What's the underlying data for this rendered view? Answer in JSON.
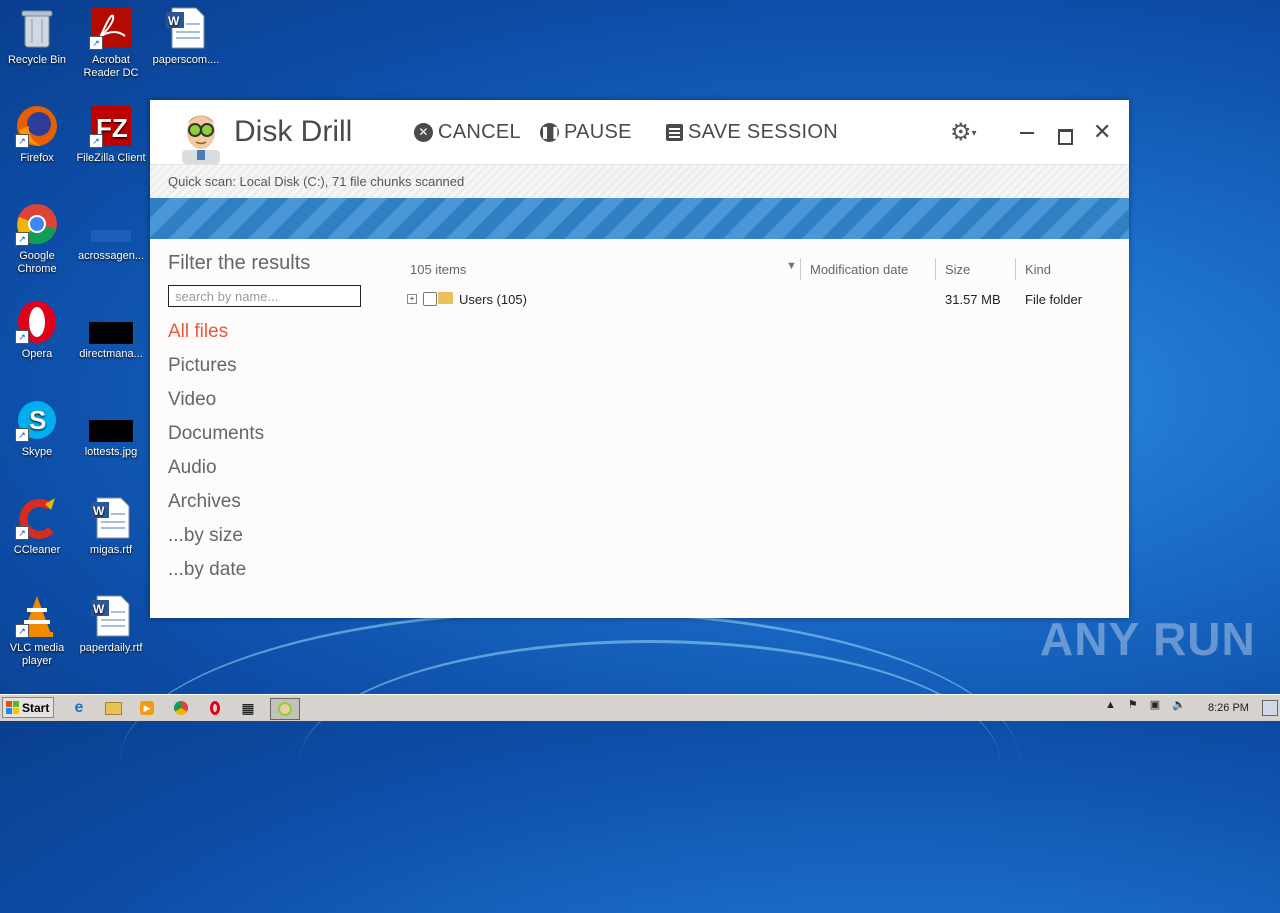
{
  "desktop_icons": [
    {
      "label": "Recycle Bin"
    },
    {
      "label": "Acrobat Reader DC"
    },
    {
      "label": "paperscom...."
    },
    {
      "label": "Firefox"
    },
    {
      "label": "FileZilla Client"
    },
    {
      "label": "Google Chrome"
    },
    {
      "label": "acrossagen..."
    },
    {
      "label": "Opera"
    },
    {
      "label": "directmana..."
    },
    {
      "label": "Skype"
    },
    {
      "label": "lottests.jpg"
    },
    {
      "label": "CCleaner"
    },
    {
      "label": "migas.rtf"
    },
    {
      "label": "VLC media player"
    },
    {
      "label": "paperdaily.rtf"
    }
  ],
  "app": {
    "title": "Disk Drill",
    "cancel_label": "CANCEL",
    "pause_label": "PAUSE",
    "save_label": "SAVE SESSION",
    "status_text": "Quick scan: Local Disk (C:), 71 file chunks scanned"
  },
  "sidebar": {
    "filter_title": "Filter the results",
    "search_placeholder": "search by name...",
    "categories": [
      "All files",
      "Pictures",
      "Video",
      "Documents",
      "Audio",
      "Archives",
      "...by size",
      "...by date"
    ]
  },
  "list": {
    "count": "105 items",
    "columns": {
      "date": "Modification date",
      "size": "Size",
      "kind": "Kind"
    },
    "rows": [
      {
        "name": "Users (105)",
        "date": "",
        "size": "31.57 MB",
        "kind": "File folder"
      }
    ]
  },
  "watermark": "ANY RUN",
  "taskbar": {
    "start_label": "Start",
    "time": "8:26 PM"
  },
  "colors": {
    "accent": "#e8583d",
    "progress": "#2f7fc4",
    "desktop": "#1a6cc8"
  }
}
